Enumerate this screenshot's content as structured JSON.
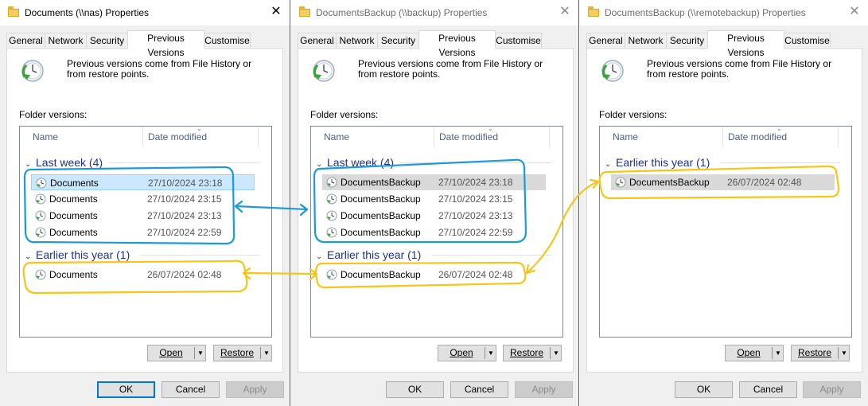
{
  "dialogs": [
    {
      "title": "Documents (\\\\nas) Properties",
      "tabs": [
        "General",
        "Network",
        "Security",
        "Previous Versions",
        "Customise"
      ],
      "active_tab": "Previous Versions",
      "info": "Previous versions come from File History or from restore points.",
      "folder_versions_label": "Folder versions:",
      "columns": [
        "Name",
        "Date modified"
      ],
      "groups": [
        {
          "label": "Last week (4)",
          "items": [
            {
              "name": "Documents",
              "date": "27/10/2024 23:18",
              "selected": "blue"
            },
            {
              "name": "Documents",
              "date": "27/10/2024 23:15"
            },
            {
              "name": "Documents",
              "date": "27/10/2024 23:13"
            },
            {
              "name": "Documents",
              "date": "27/10/2024 22:59"
            }
          ]
        },
        {
          "label": "Earlier this year (1)",
          "items": [
            {
              "name": "Documents",
              "date": "26/07/2024 02:48"
            }
          ]
        }
      ],
      "open_label": "Open",
      "restore_label": "Restore",
      "ok_label": "OK",
      "cancel_label": "Cancel",
      "apply_label": "Apply"
    },
    {
      "title": "DocumentsBackup (\\\\backup) Properties",
      "tabs": [
        "General",
        "Network",
        "Security",
        "Previous Versions",
        "Customise"
      ],
      "active_tab": "Previous Versions",
      "info": "Previous versions come from File History or from restore points.",
      "folder_versions_label": "Folder versions:",
      "columns": [
        "Name",
        "Date modified"
      ],
      "groups": [
        {
          "label": "Last week (4)",
          "items": [
            {
              "name": "DocumentsBackup",
              "date": "27/10/2024 23:18",
              "selected": "grey"
            },
            {
              "name": "DocumentsBackup",
              "date": "27/10/2024 23:15"
            },
            {
              "name": "DocumentsBackup",
              "date": "27/10/2024 23:13"
            },
            {
              "name": "DocumentsBackup",
              "date": "27/10/2024 22:59"
            }
          ]
        },
        {
          "label": "Earlier this year (1)",
          "items": [
            {
              "name": "DocumentsBackup",
              "date": "26/07/2024 02:48"
            }
          ]
        }
      ],
      "open_label": "Open",
      "restore_label": "Restore",
      "ok_label": "OK",
      "cancel_label": "Cancel",
      "apply_label": "Apply"
    },
    {
      "title": "DocumentsBackup (\\\\remotebackup) Properties",
      "tabs": [
        "General",
        "Network",
        "Security",
        "Previous Versions",
        "Customise"
      ],
      "active_tab": "Previous Versions",
      "info": "Previous versions come from File History or from restore points.",
      "folder_versions_label": "Folder versions:",
      "columns": [
        "Name",
        "Date modified"
      ],
      "groups": [
        {
          "label": "Earlier this year (1)",
          "items": [
            {
              "name": "DocumentsBackup",
              "date": "26/07/2024 02:48",
              "selected": "grey"
            }
          ]
        }
      ],
      "open_label": "Open",
      "restore_label": "Restore",
      "ok_label": "OK",
      "cancel_label": "Cancel",
      "apply_label": "Apply"
    }
  ],
  "colors": {
    "blue_annotation": "#1b9ad6",
    "yellow_annotation": "#f5c518",
    "selection_blue": "#cce8ff",
    "selection_grey": "#d9d9d9",
    "group_header": "#1e3287"
  },
  "icons": {
    "title": "folder-icon",
    "history": "file-history-clock-icon",
    "version": "version-clock-icon",
    "close": "close-icon"
  }
}
